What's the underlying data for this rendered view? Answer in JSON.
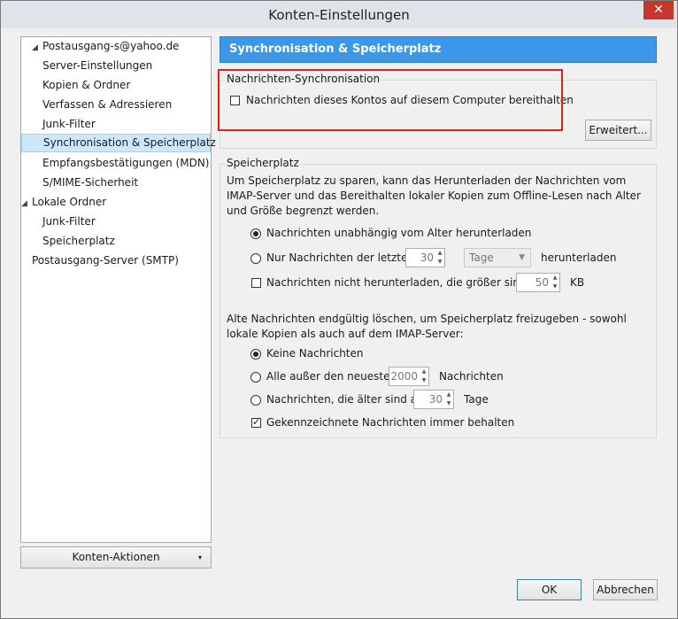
{
  "window": {
    "title": "Konten-Einstellungen",
    "close_label": "✕"
  },
  "tree": {
    "items": [
      {
        "label": "Postausgang-s@yahoo.de",
        "level": 1,
        "expanded": true
      },
      {
        "label": "Server-Einstellungen",
        "level": 2
      },
      {
        "label": "Kopien & Ordner",
        "level": 2
      },
      {
        "label": "Verfassen & Adressieren",
        "level": 2
      },
      {
        "label": "Junk-Filter",
        "level": 2
      },
      {
        "label": "Synchronisation & Speicherplatz",
        "level": 2,
        "selected": true
      },
      {
        "label": "Empfangsbestätigungen (MDN)",
        "level": 2
      },
      {
        "label": "S/MIME-Sicherheit",
        "level": 2
      },
      {
        "label": "Lokale Ordner",
        "level": 1,
        "expanded": true
      },
      {
        "label": "Junk-Filter",
        "level": 2
      },
      {
        "label": "Speicherplatz",
        "level": 2
      },
      {
        "label": "Postausgang-Server (SMTP)",
        "level": 1
      }
    ]
  },
  "account_actions": {
    "label": "Konten-Aktionen",
    "arrow": "▾"
  },
  "page": {
    "title": "Synchronisation & Speicherplatz"
  },
  "sync": {
    "legend": "Nachrichten-Synchronisation",
    "keep_local_label": "Nachrichten dieses Kontos auf diesem Computer bereithalten",
    "keep_local_checked": false,
    "advanced_button": "Erweitert..."
  },
  "storage": {
    "legend": "Speicherplatz",
    "intro": "Um Speicherplatz zu sparen, kann das Herunterladen der Nachrichten vom IMAP-Server und das Bereithalten lokaler Kopien zum Offline-Lesen nach Alter und Größe begrenzt werden.",
    "download_all_label": "Nachrichten unabhängig vom Alter herunterladen",
    "download_recent_label": "Nur Nachrichten der letzten",
    "download_recent_value": "30",
    "download_recent_unit": "Tage",
    "download_recent_suffix": "herunterladen",
    "size_limit_label": "Nachrichten nicht herunterladen, die größer sind als",
    "size_limit_value": "50",
    "size_limit_unit": "KB",
    "delete_intro": "Alte Nachrichten endgültig löschen, um Speicherplatz freizugeben - sowohl lokale Kopien als auch auf dem IMAP-Server:",
    "delete_none_label": "Keine Nachrichten",
    "delete_all_but_label": "Alle außer den neuesten",
    "delete_all_but_value": "2000",
    "delete_all_but_suffix": "Nachrichten",
    "delete_older_label": "Nachrichten, die älter sind als",
    "delete_older_value": "30",
    "delete_older_suffix": "Tage",
    "keep_flagged_label": "Gekennzeichnete Nachrichten immer behalten",
    "keep_flagged_checked": true
  },
  "footer": {
    "ok_label": "OK",
    "cancel_label": "Abbrechen"
  },
  "colors": {
    "header_bg": "#3c97e8",
    "selection_bg": "#cce8ff",
    "highlight_box": "#e02020",
    "close_bg": "#c7352c"
  }
}
